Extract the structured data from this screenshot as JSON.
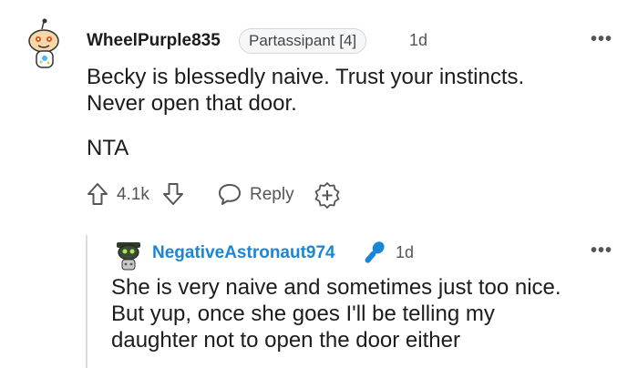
{
  "comment": {
    "username": "WheelPurple835",
    "flair": "Partassipant [4]",
    "time": "1d",
    "body_lines": [
      "Becky is blessedly naive. Trust your instincts.",
      "Never open that door."
    ],
    "second_paragraph": "NTA",
    "vote_count": "4.1k",
    "reply_label": "Reply",
    "more_label": "•••",
    "icons": [
      "snoo-avatar",
      "upvote-arrow-icon",
      "downvote-arrow-icon",
      "speech-bubble-icon",
      "award-add-icon",
      "more-dots-icon"
    ]
  },
  "reply": {
    "username": "NegativeAstronaut974",
    "time": "1d",
    "body_lines": [
      "She is very naive and sometimes just too nice.",
      "But yup, once she goes I'll be telling my",
      "daughter not to open the door either"
    ],
    "more_label": "•••",
    "icons": [
      "snoo-avatar",
      "microphone-icon",
      "more-dots-icon"
    ]
  },
  "colors": {
    "reply_username": "#1a86d8",
    "mic_icon": "#1a86d8"
  }
}
